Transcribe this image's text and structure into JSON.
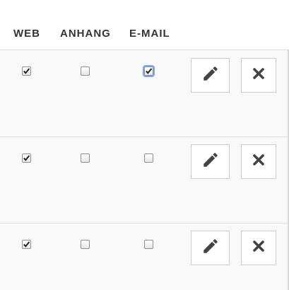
{
  "table": {
    "columns": [
      "WEB",
      "ANHANG",
      "E-MAIL"
    ],
    "rows": [
      {
        "web": true,
        "anhang": false,
        "email": true,
        "email_focused": true
      },
      {
        "web": true,
        "anhang": false,
        "email": false
      },
      {
        "web": true,
        "anhang": false,
        "email": false
      }
    ],
    "actions": {
      "edit_icon": "pencil-icon",
      "delete_icon": "close-icon"
    }
  },
  "colors": {
    "header_text": "#333333",
    "row_background": "#f9f9f9",
    "divider": "#dedede",
    "button_border": "#cccccc",
    "icon": "#444444",
    "focus": "#7aa7ee"
  }
}
